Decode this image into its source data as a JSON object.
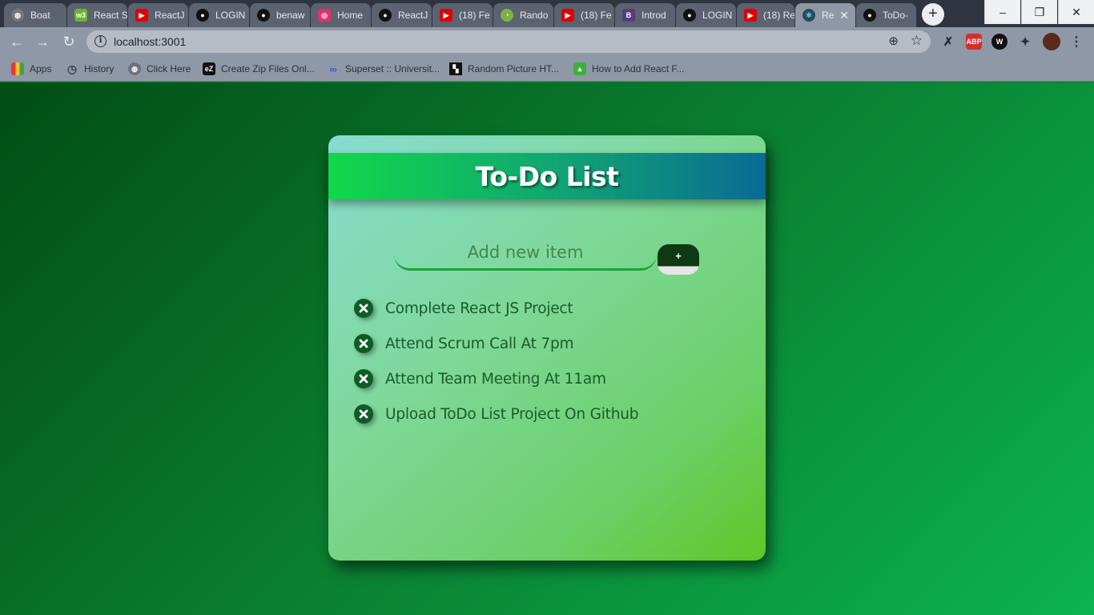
{
  "browser": {
    "tabs": [
      {
        "title": "Boat",
        "icon": "globe-icon",
        "color": "#777777"
      },
      {
        "title": "React S",
        "icon": "w3schools-icon",
        "color": "#6ab52f"
      },
      {
        "title": "ReactJ",
        "icon": "youtube-icon",
        "color": "#e00000"
      },
      {
        "title": "LOGIN",
        "icon": "github-icon",
        "color": "#111111"
      },
      {
        "title": "benaw",
        "icon": "github-icon",
        "color": "#111111"
      },
      {
        "title": "Home",
        "icon": "instagram-icon",
        "color": "#e1306c"
      },
      {
        "title": "ReactJ",
        "icon": "github-icon",
        "color": "#111111"
      },
      {
        "title": "(18) Fe",
        "icon": "youtube-icon",
        "color": "#e00000"
      },
      {
        "title": "Rando",
        "icon": "android-icon",
        "color": "#7cb342"
      },
      {
        "title": "(18) Fe",
        "icon": "youtube-icon",
        "color": "#e00000"
      },
      {
        "title": "Introd",
        "icon": "bootstrap-icon",
        "color": "#563d7c"
      },
      {
        "title": "LOGIN",
        "icon": "github-icon",
        "color": "#111111"
      },
      {
        "title": "(18) Re",
        "icon": "youtube-icon",
        "color": "#e00000"
      },
      {
        "title": "Re",
        "icon": "react-icon",
        "color": "#61dafb"
      },
      {
        "title": "ToDo-",
        "icon": "github-icon",
        "color": "#111111"
      }
    ],
    "new_tab": "+",
    "window_controls": {
      "minimize": "–",
      "restore": "❐",
      "close": "✕"
    },
    "url": "localhost:3001",
    "bookmarks": [
      {
        "label": "Apps",
        "icon": "apps-grid-icon"
      },
      {
        "label": "History",
        "icon": "history-icon"
      },
      {
        "label": "Click Here",
        "icon": "globe-icon"
      },
      {
        "label": "Create Zip Files Onl...",
        "icon": "ez-icon"
      },
      {
        "label": "Superset :: Universit...",
        "icon": "superset-icon"
      },
      {
        "label": "Random Picture HT...",
        "icon": "unsplash-icon"
      },
      {
        "label": "How to Add React F...",
        "icon": "bookmark-site-icon"
      }
    ]
  },
  "app": {
    "title": "To-Do List",
    "input_placeholder": "Add new item",
    "add_button_label": "+",
    "items": [
      "Complete React JS Project",
      "Attend Scrum Call At 7pm",
      "Attend Team Meeting At 11am",
      "Upload ToDo List Project On Github"
    ]
  }
}
